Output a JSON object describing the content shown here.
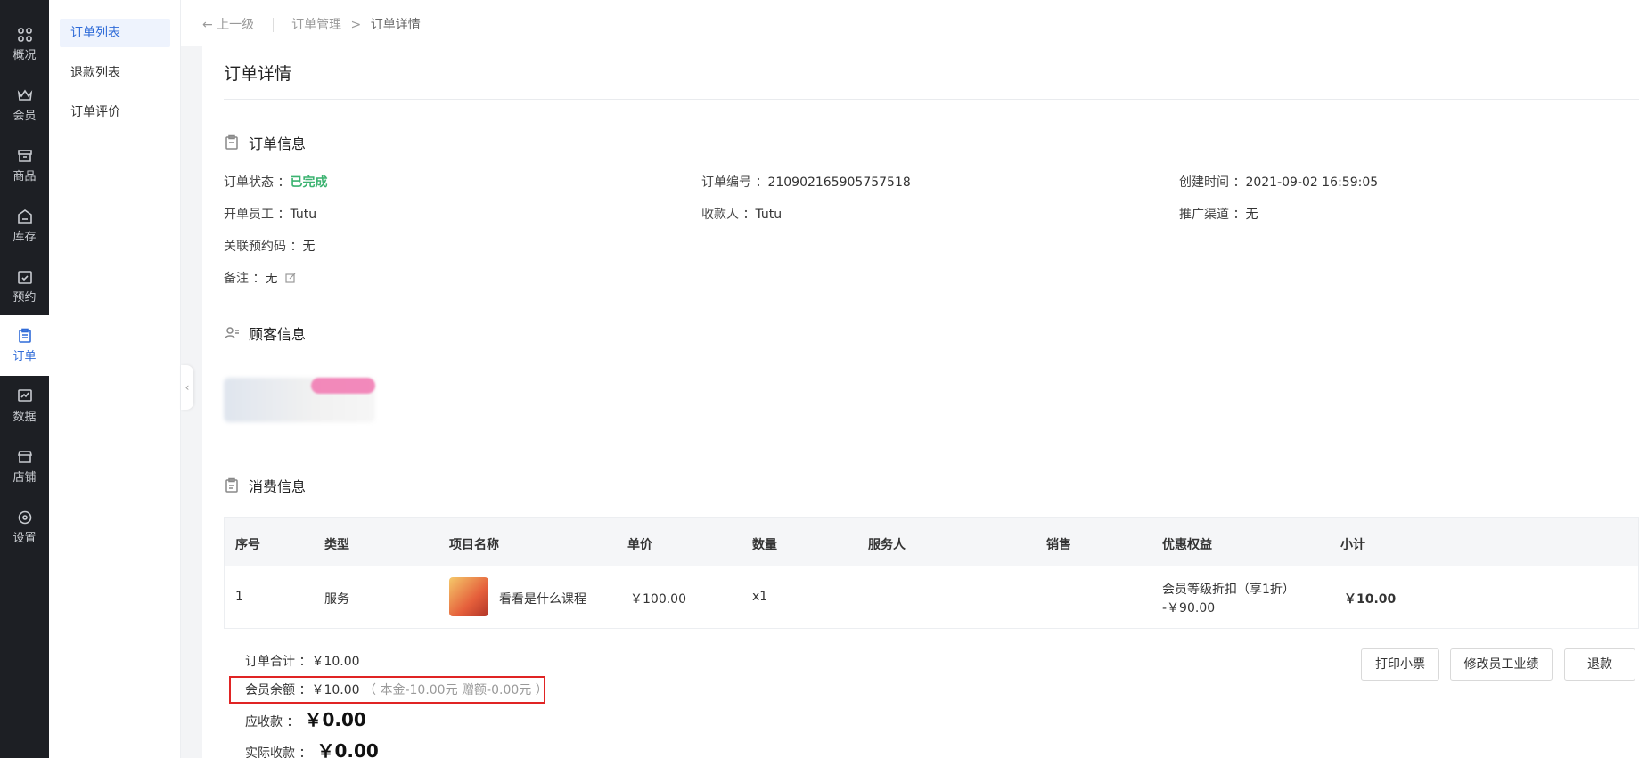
{
  "nav": [
    {
      "label": "概况",
      "icon": "grid-icon"
    },
    {
      "label": "会员",
      "icon": "crown-icon"
    },
    {
      "label": "商品",
      "icon": "store-box-icon"
    },
    {
      "label": "库存",
      "icon": "warehouse-icon"
    },
    {
      "label": "预约",
      "icon": "calendar-check-icon"
    },
    {
      "label": "订单",
      "icon": "clipboard-icon",
      "active": true
    },
    {
      "label": "数据",
      "icon": "chart-icon"
    },
    {
      "label": "店铺",
      "icon": "shop-icon"
    },
    {
      "label": "设置",
      "icon": "settings-icon"
    }
  ],
  "subnav": [
    {
      "label": "订单列表",
      "active": true
    },
    {
      "label": "退款列表"
    },
    {
      "label": "订单评价"
    }
  ],
  "breadcrumb": {
    "back": "上一级",
    "parent": "订单管理",
    "separator": ">",
    "current": "订单详情"
  },
  "page_title": "订单详情",
  "order_info": {
    "heading": "订单信息",
    "status_label": "订单状态 ：",
    "status_value": "已完成",
    "order_no_label": "订单编号 ：",
    "order_no_value": "210902165905757518",
    "created_label": "创建时间 ：",
    "created_value": "2021-09-02 16:59:05",
    "staff_label": "开单员工 ：",
    "staff_value": "Tutu",
    "payee_label": "收款人 ：",
    "payee_value": "Tutu",
    "channel_label": "推广渠道 ：",
    "channel_value": "无",
    "booking_label": "关联预约码 ：",
    "booking_value": "无",
    "remark_label": "备注 ：",
    "remark_value": "无"
  },
  "customer_info": {
    "heading": "顾客信息"
  },
  "consume_info": {
    "heading": "消费信息",
    "columns": [
      "序号",
      "类型",
      "项目名称",
      "单价",
      "数量",
      "服务人",
      "销售",
      "优惠权益",
      "小计"
    ],
    "rows": [
      {
        "index": "1",
        "type": "服务",
        "name": "看看是什么课程",
        "price": "￥100.00",
        "qty": "x1",
        "server": "",
        "sales": "",
        "discount_line1": "会员等级折扣（享1折）",
        "discount_line2": "-￥90.00",
        "subtotal": "￥10.00"
      }
    ]
  },
  "summary": {
    "total_label": "订单合计 ：",
    "total_value": "￥10.00",
    "balance_label": "会员余额 ：",
    "balance_value": "￥10.00",
    "balance_detail": "（ 本金-10.00元 赠额-0.00元 ）",
    "receivable_label": "应收款 ：",
    "receivable_value": "￥0.00",
    "received_label": "实际收款 ：",
    "received_value": "￥0.00"
  },
  "buttons": {
    "print": "打印小票",
    "edit_perf": "修改员工业绩",
    "refund": "退款"
  },
  "colors": {
    "accent": "#2f6bd8",
    "success": "#3cb371",
    "highlight": "#e02424",
    "nav_bg": "#1d1f24"
  }
}
